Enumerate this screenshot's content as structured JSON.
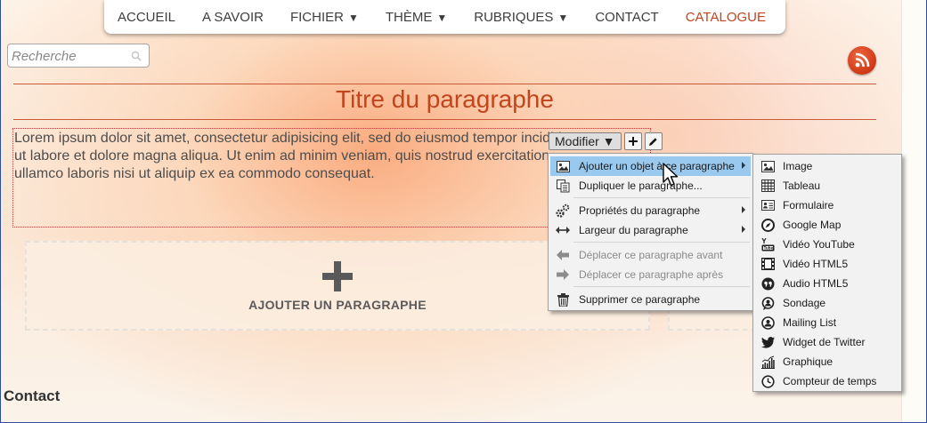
{
  "nav": {
    "items": [
      {
        "label": "ACCUEIL",
        "caret": ""
      },
      {
        "label": "A SAVOIR",
        "caret": ""
      },
      {
        "label": "FICHIER",
        "caret": "▼"
      },
      {
        "label": "THÈME",
        "caret": "▼"
      },
      {
        "label": "RUBRIQUES",
        "caret": "▼"
      },
      {
        "label": "CONTACT",
        "caret": ""
      },
      {
        "label": "CATALOGUE",
        "caret": ""
      }
    ],
    "active_color": "#c2451d"
  },
  "search": {
    "placeholder": "Recherche"
  },
  "paragraph": {
    "title": "Titre du paragraphe",
    "lines": [
      "Lorem ipsum dolor sit amet, consectetur adipisicing elit, sed do eiusmod tempor incididunt",
      "ut labore et dolore magna aliqua. Ut enim ad minim veniam, quis nostrud exercitation",
      "ullamco laboris nisi ut aliquip ex ea commodo consequat."
    ]
  },
  "toolbar": {
    "modifier_label": "Modifier ▼"
  },
  "add_paragraph": {
    "label": "AJOUTER UN PARAGRAPHE"
  },
  "footer": {
    "contact": "Contact"
  },
  "context_menu": {
    "items": [
      {
        "label": "Ajouter un objet à ce paragraphe",
        "icon": "image-icon",
        "submenu": true,
        "highlighted": true,
        "disabled": false
      },
      {
        "label": "Dupliquer le paragraphe...",
        "icon": "duplicate-icon",
        "submenu": false,
        "highlighted": false,
        "disabled": false
      },
      {
        "label": "Propriétés du paragraphe",
        "icon": "gears-icon",
        "submenu": true,
        "highlighted": false,
        "disabled": false
      },
      {
        "label": "Largeur du paragraphe",
        "icon": "width-arrows-icon",
        "submenu": true,
        "highlighted": false,
        "disabled": false
      },
      {
        "label": "Déplacer ce paragraphe avant",
        "icon": "arrow-left-icon",
        "submenu": false,
        "highlighted": false,
        "disabled": true
      },
      {
        "label": "Déplacer ce paragraphe après",
        "icon": "arrow-right-icon",
        "submenu": false,
        "highlighted": false,
        "disabled": true
      },
      {
        "label": "Supprimer ce paragraphe",
        "icon": "trash-icon",
        "submenu": false,
        "highlighted": false,
        "disabled": false
      }
    ]
  },
  "submenu": {
    "items": [
      {
        "label": "Image",
        "icon": "picture-icon"
      },
      {
        "label": "Tableau",
        "icon": "table-icon"
      },
      {
        "label": "Formulaire",
        "icon": "form-icon"
      },
      {
        "label": "Google Map",
        "icon": "compass-icon"
      },
      {
        "label": "Vidéo YouTube",
        "icon": "youtube-icon"
      },
      {
        "label": "Vidéo HTML5",
        "icon": "film-icon"
      },
      {
        "label": "Audio HTML5",
        "icon": "quote-icon"
      },
      {
        "label": "Sondage",
        "icon": "poll-icon"
      },
      {
        "label": "Mailing List",
        "icon": "mailing-list-icon"
      },
      {
        "label": "Widget de Twitter",
        "icon": "twitter-icon"
      },
      {
        "label": "Graphique",
        "icon": "chart-icon"
      },
      {
        "label": "Compteur de temps",
        "icon": "clock-icon"
      }
    ]
  },
  "colors": {
    "accent": "#c2451d",
    "menu_highlight": "#99c9ef",
    "rss": "#d63d1a"
  }
}
